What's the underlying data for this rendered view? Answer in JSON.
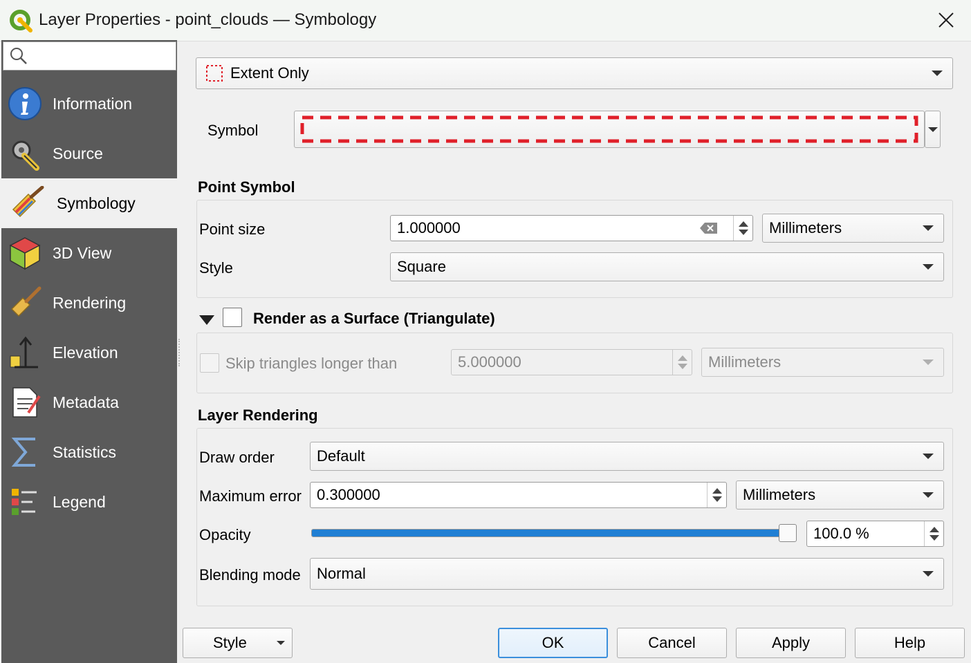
{
  "window": {
    "title": "Layer Properties - point_clouds — Symbology",
    "close_glyph": "✕"
  },
  "search": {
    "placeholder": ""
  },
  "sidebar": {
    "items": [
      {
        "label": "Information",
        "icon": "info-icon"
      },
      {
        "label": "Source",
        "icon": "source-tools-icon"
      },
      {
        "label": "Symbology",
        "icon": "paintbrush-icon",
        "active": true
      },
      {
        "label": "3D View",
        "icon": "cube-icon"
      },
      {
        "label": "Rendering",
        "icon": "brush-icon"
      },
      {
        "label": "Elevation",
        "icon": "elevation-icon"
      },
      {
        "label": "Metadata",
        "icon": "metadata-icon"
      },
      {
        "label": "Statistics",
        "icon": "sigma-icon"
      },
      {
        "label": "Legend",
        "icon": "legend-icon"
      }
    ]
  },
  "renderer": {
    "value": "Extent Only"
  },
  "symbol": {
    "label": "Symbol",
    "line_color": "#e0202a"
  },
  "point_symbol": {
    "title": "Point Symbol",
    "size_label": "Point size",
    "size_value": "1.000000",
    "size_unit": "Millimeters",
    "style_label": "Style",
    "style_value": "Square"
  },
  "surface": {
    "title": "Render as a Surface (Triangulate)",
    "skip_label": "Skip triangles longer than",
    "skip_value": "5.000000",
    "skip_unit": "Millimeters"
  },
  "layer_rendering": {
    "title": "Layer Rendering",
    "draw_order_label": "Draw order",
    "draw_order_value": "Default",
    "max_error_label": "Maximum error",
    "max_error_value": "0.300000",
    "max_error_unit": "Millimeters",
    "opacity_label": "Opacity",
    "opacity_value": "100.0 %",
    "opacity_fraction": 1.0,
    "blending_label": "Blending mode",
    "blending_value": "Normal"
  },
  "buttons": {
    "style": "Style",
    "ok": "OK",
    "cancel": "Cancel",
    "apply": "Apply",
    "help": "Help"
  },
  "colors": {
    "accent": "#1f7fd4",
    "sidebar": "#5a5a5a"
  }
}
